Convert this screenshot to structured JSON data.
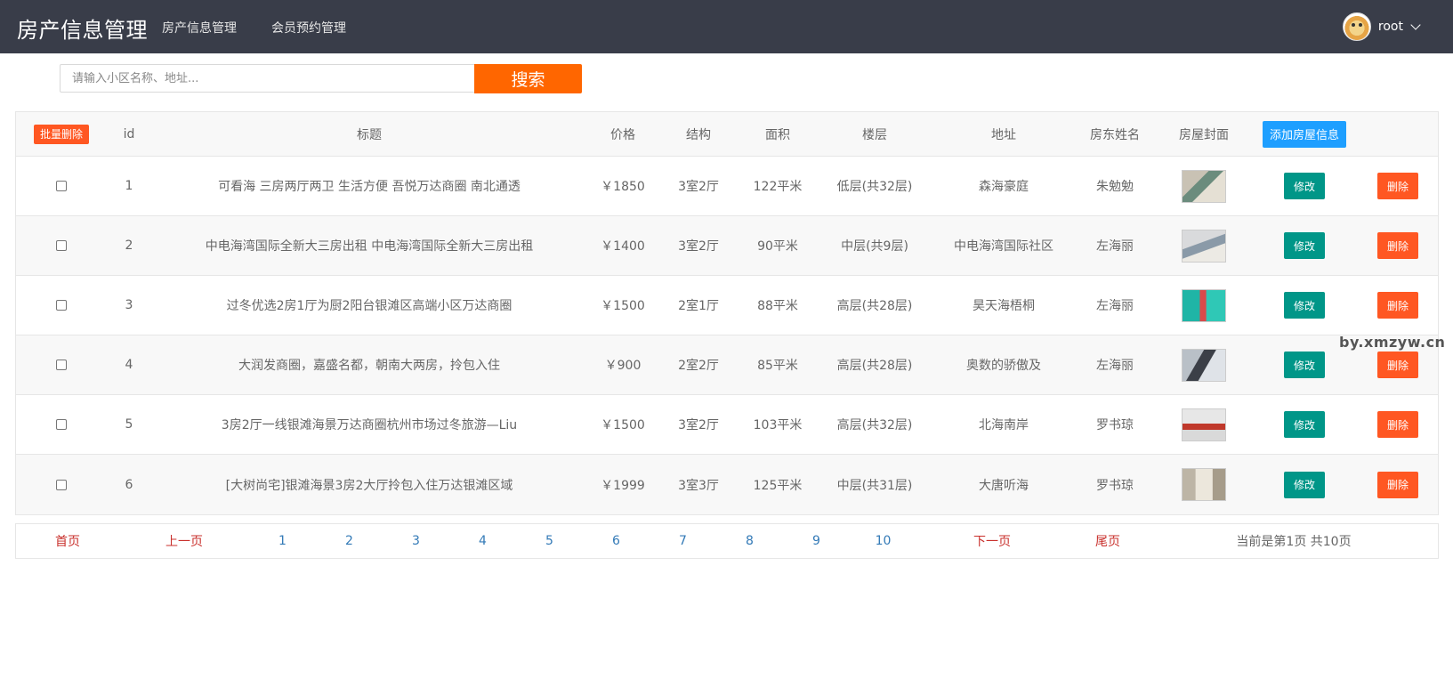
{
  "header": {
    "brand": "房产信息管理",
    "nav": [
      "房产信息管理",
      "会员预约管理"
    ],
    "user": "root"
  },
  "search": {
    "placeholder": "请输入小区名称、地址...",
    "value": "",
    "button": "搜索"
  },
  "table": {
    "batch_delete": "批量删除",
    "add_button": "添加房屋信息",
    "columns": [
      "id",
      "标题",
      "价格",
      "结构",
      "面积",
      "楼层",
      "地址",
      "房东姓名",
      "房屋封面"
    ],
    "edit_label": "修改",
    "delete_label": "删除",
    "rows": [
      {
        "id": "1",
        "title": "可看海 三房两厅两卫 生活方便 吾悦万达商圈 南北通透",
        "price": "￥1850",
        "layout": "3室2厅",
        "area": "122平米",
        "floor": "低层(共32层)",
        "address": "森海豪庭",
        "landlord": "朱勉勉",
        "checked": false
      },
      {
        "id": "2",
        "title": "中电海湾国际全新大三房出租 中电海湾国际全新大三房出租",
        "price": "￥1400",
        "layout": "3室2厅",
        "area": "90平米",
        "floor": "中层(共9层)",
        "address": "中电海湾国际社区",
        "landlord": "左海丽",
        "checked": false
      },
      {
        "id": "3",
        "title": "过冬优选2房1厅为厨2阳台银滩区高端小区万达商圈",
        "price": "￥1500",
        "layout": "2室1厅",
        "area": "88平米",
        "floor": "高层(共28层)",
        "address": "昊天海梧桐",
        "landlord": "左海丽",
        "checked": false
      },
      {
        "id": "4",
        "title": "大润发商圈，嘉盛名都，朝南大两房，拎包入住",
        "price": "￥900",
        "layout": "2室2厅",
        "area": "85平米",
        "floor": "高层(共28层)",
        "address": "奥数的骄傲及",
        "landlord": "左海丽",
        "checked": false
      },
      {
        "id": "5",
        "title": "3房2厅一线银滩海景万达商圈杭州市场过冬旅游—Liu",
        "price": "￥1500",
        "layout": "3室2厅",
        "area": "103平米",
        "floor": "高层(共32层)",
        "address": "北海南岸",
        "landlord": "罗书琼",
        "checked": false
      },
      {
        "id": "6",
        "title": "[大树尚宅]银滩海景3房2大厅拎包入住万达银滩区域",
        "price": "￥1999",
        "layout": "3室3厅",
        "area": "125平米",
        "floor": "中层(共31层)",
        "address": "大唐听海",
        "landlord": "罗书琼",
        "checked": false
      }
    ]
  },
  "pagination": {
    "first": "首页",
    "prev": "上一页",
    "pages": [
      "1",
      "2",
      "3",
      "4",
      "5",
      "6",
      "7",
      "8",
      "9",
      "10"
    ],
    "next": "下一页",
    "last": "尾页",
    "info": "当前是第1页 共10页"
  },
  "watermark": "by.xmzyw.cn",
  "colors": {
    "header_bg": "#393D49",
    "search_button": "#FF6600",
    "edit_button": "#009688",
    "delete_button": "#FF5722",
    "add_button": "#1E9FFF",
    "page_link_red": "#c9302c",
    "page_link_blue": "#337ab7"
  }
}
